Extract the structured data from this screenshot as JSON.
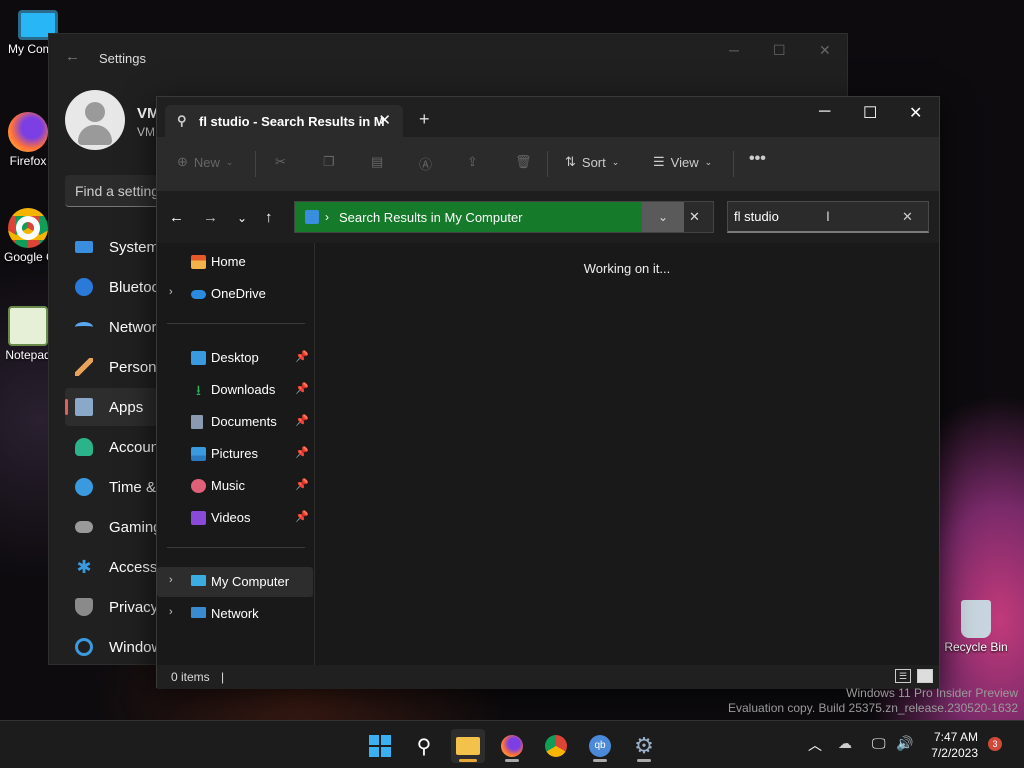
{
  "desktop": {
    "icons": [
      {
        "label": "My Computer",
        "icon": "monitor-icon"
      },
      {
        "label": "Firefox",
        "icon": "firefox-icon"
      },
      {
        "label": "Google Chrome",
        "icon": "chrome-icon"
      },
      {
        "label": "Notepad",
        "icon": "notepad-icon"
      },
      {
        "label": "Recycle Bin",
        "icon": "recycle-bin-icon"
      }
    ],
    "watermark_line1": "Windows 11 Pro Insider Preview",
    "watermark_line2": "Evaluation copy. Build 25375.zn_release.230520-1632"
  },
  "settings": {
    "title": "Settings",
    "account_name": "VM",
    "account_sub": "VM",
    "find_placeholder": "Find a setting",
    "nav": [
      {
        "label": "System",
        "icon": "system-icon"
      },
      {
        "label": "Bluetooth & devices",
        "icon": "bluetooth-icon"
      },
      {
        "label": "Network & internet",
        "icon": "wifi-icon"
      },
      {
        "label": "Personalization",
        "icon": "brush-icon"
      },
      {
        "label": "Apps",
        "icon": "apps-icon",
        "active": true
      },
      {
        "label": "Accounts",
        "icon": "account-icon"
      },
      {
        "label": "Time & language",
        "icon": "globe-icon"
      },
      {
        "label": "Gaming",
        "icon": "gamepad-icon"
      },
      {
        "label": "Accessibility",
        "icon": "accessibility-icon"
      },
      {
        "label": "Privacy & security",
        "icon": "shield-icon"
      },
      {
        "label": "Windows Update",
        "icon": "update-icon"
      }
    ]
  },
  "explorer": {
    "tab_title": "fl studio - Search Results in M",
    "commands": {
      "new": "New",
      "sort": "Sort",
      "view": "View"
    },
    "address": {
      "path": "Search Results in My Computer"
    },
    "search": {
      "value": "fl studio"
    },
    "nav_pane": {
      "top": [
        {
          "label": "Home",
          "icon": "home-icon"
        },
        {
          "label": "OneDrive",
          "icon": "onedrive-icon"
        }
      ],
      "quick": [
        {
          "label": "Desktop",
          "icon": "desktop-folder-icon"
        },
        {
          "label": "Downloads",
          "icon": "download-icon"
        },
        {
          "label": "Documents",
          "icon": "documents-icon"
        },
        {
          "label": "Pictures",
          "icon": "pictures-icon"
        },
        {
          "label": "Music",
          "icon": "music-icon"
        },
        {
          "label": "Videos",
          "icon": "videos-icon"
        }
      ],
      "bottom": [
        {
          "label": "My Computer",
          "icon": "computer-icon"
        },
        {
          "label": "Network",
          "icon": "network-icon"
        }
      ]
    },
    "content_status": "Working on it...",
    "status_items": "0 items"
  },
  "taskbar": {
    "time": "7:47 AM",
    "date": "7/2/2023",
    "notification_count": "3"
  },
  "colors": {
    "address_highlight": "#157a2a",
    "accent_indicator": "#e8a838"
  }
}
